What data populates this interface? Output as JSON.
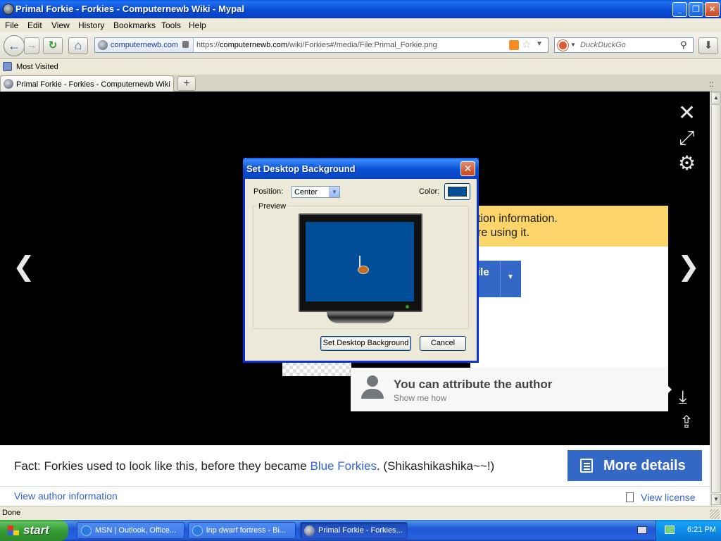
{
  "window": {
    "title": "Primal Forkie - Forkies - Computernewb Wiki - Mypal",
    "minimize": "_",
    "maximize": "❐",
    "close": "✕"
  },
  "menu": [
    "File",
    "Edit",
    "View",
    "History",
    "Bookmarks",
    "Tools",
    "Help"
  ],
  "nav": {
    "back": "←",
    "forward": "→",
    "reload": "↻",
    "home": "⌂",
    "identity_domain": "computernewb.com",
    "url_prefix": "https://",
    "url_host": "computernewb.com",
    "url_path": "/wiki/Forkies#/media/File:Primal_Forkie.png",
    "bookmark_star": "☆",
    "url_dropdown": "▼",
    "search_placeholder": "DuckDuckGo",
    "search_caret": "▼",
    "search_glass": "⚲",
    "downloads": "⬇"
  },
  "bookmarks": {
    "item": "Most Visited"
  },
  "tabs": {
    "active": "Primal Forkie - Forkies - Computernewb Wiki",
    "new_tab": "+",
    "list_all": "::"
  },
  "viewer": {
    "close": "✕",
    "fullscreen": "⤢",
    "settings": "⚙",
    "prev": "❮",
    "next": "❯",
    "download": "⤓",
    "share": "⇪",
    "banner_line1": "tion information.",
    "banner_line2": "re using it.",
    "use_file_label": "ile",
    "use_file_arrow": "▼",
    "attribute_title": "You can attribute the author",
    "attribute_sub": "Show me how"
  },
  "footer": {
    "fact_prefix": "Fact: Forkies used to look like this, before they became ",
    "fact_link": "Blue Forkies",
    "fact_suffix": ". (Shikashikashika~~!)",
    "more_details": "More details",
    "view_author": "View author information",
    "view_license": "View license"
  },
  "dialog": {
    "title": "Set Desktop Background",
    "close": "✕",
    "position_label": "Position:",
    "position_value": "Center",
    "position_arrow": "▼",
    "color_label": "Color:",
    "color_value": "#004e98",
    "preview_label": "Preview",
    "set_button": "Set Desktop Background",
    "cancel_button": "Cancel"
  },
  "status": {
    "text": "Done"
  },
  "scroll": {
    "up": "▲",
    "down": "▼"
  },
  "taskbar": {
    "start": "start",
    "tasks": [
      {
        "label": "MSN | Outlook, Office..."
      },
      {
        "label": "lnp dwarf fortress - Bi..."
      },
      {
        "label": "Primal Forkie - Forkies..."
      }
    ],
    "clock": "6:21 PM"
  },
  "colors": {
    "accent_blue": "#3468c7",
    "link_blue": "#3366cc",
    "banner_yellow": "#fcd56a",
    "desktop_blue": "#004e98"
  }
}
